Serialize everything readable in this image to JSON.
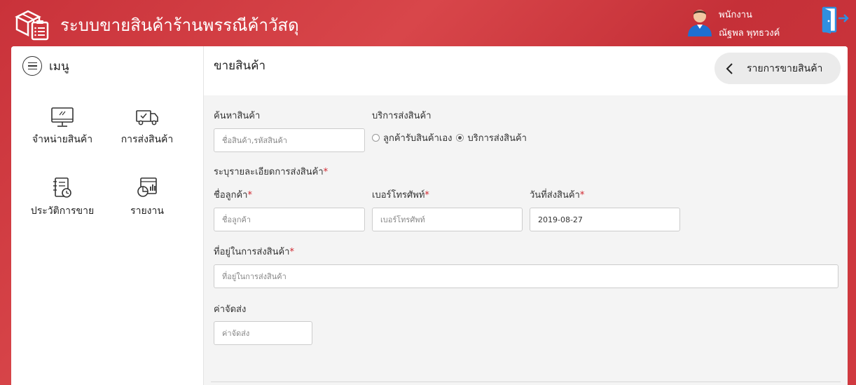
{
  "header": {
    "app_title": "ระบบขายสินค้าร้านพรรณีค้าวัสดุ",
    "user_role": "พนักงาน",
    "user_name": "ณัฐพล พุทธวงค์"
  },
  "sidebar": {
    "menu_label": "เมนู",
    "items": [
      {
        "label": "จำหน่ายสินค้า",
        "icon": "monitor-icon"
      },
      {
        "label": "การส่งสินค้า",
        "icon": "delivery-truck-icon"
      },
      {
        "label": "ประวัติการขาย",
        "icon": "sales-history-icon"
      },
      {
        "label": "รายงาน",
        "icon": "report-icon"
      }
    ]
  },
  "main": {
    "page_title": "ขายสินค้า",
    "list_button": "รายการขายสินค้า",
    "search": {
      "label": "ค้นหาสินค้า",
      "placeholder": "ชื่อสินค้า,รหัสสินค้า",
      "value": ""
    },
    "delivery_service": {
      "label": "บริการส่งสินค้า",
      "options": [
        "ลูกค้ารับสินค้าเอง",
        "บริการส่งสินค้า"
      ],
      "selected": "บริการส่งสินค้า"
    },
    "delivery_details_label": "ระบุรายละเอียดการส่งสินค้า",
    "customer_name": {
      "label": "ชื่อลูกค้า",
      "placeholder": "ชื่อลูกค้า",
      "value": ""
    },
    "phone": {
      "label": "เบอร์โทรศัพท์",
      "placeholder": "เบอร์โทรศัพท์",
      "value": ""
    },
    "delivery_date": {
      "label": "วันที่ส่งสินค้า",
      "value": "2019-08-27"
    },
    "address": {
      "label": "ที่อยู่ในการส่งสินค้า",
      "placeholder": "ที่อยู่ในการส่งสินค้า",
      "value": ""
    },
    "shipping_fee": {
      "label": "ค่าจัดส่ง",
      "placeholder": "ค่าจัดส่ง",
      "value": ""
    },
    "required_mark": "*"
  },
  "colors": {
    "brand": "#cc343b",
    "required": "#d0262e",
    "logout": "#2f8fe0"
  }
}
